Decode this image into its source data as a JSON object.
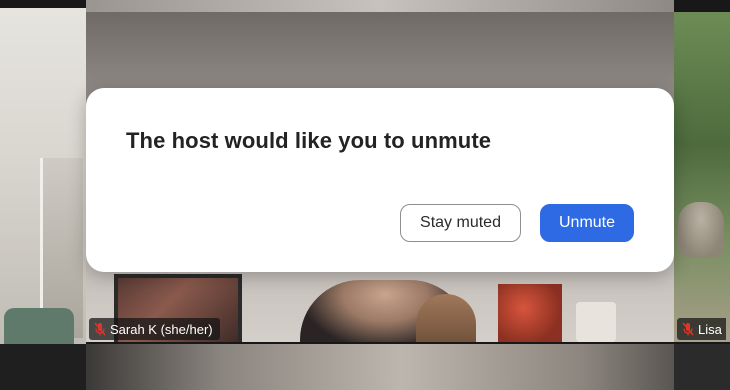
{
  "dialog": {
    "title": "The host would like you to unmute",
    "stay_muted_label": "Stay muted",
    "unmute_label": "Unmute"
  },
  "participants": [
    {
      "name": "Sarah K (she/her)",
      "muted": true
    },
    {
      "name": "Lisa",
      "muted": true
    }
  ],
  "colors": {
    "primary_button": "#2d6ae3",
    "muted_mic": "#e0352b",
    "dialog_bg": "#ffffff"
  },
  "icons": {
    "participant_mic": "mic-muted-icon"
  }
}
